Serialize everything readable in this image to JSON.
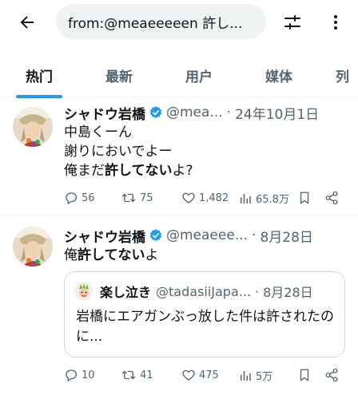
{
  "search": {
    "query": "from:@meaeeeeen 許し..."
  },
  "tabs": [
    {
      "label": "热门"
    },
    {
      "label": "最新"
    },
    {
      "label": "用户"
    },
    {
      "label": "媒体"
    },
    {
      "label": "列"
    }
  ],
  "tweets": [
    {
      "name": "シャドウ岩橋",
      "handle": "@mea...",
      "dot": "·",
      "date": "24年10月1日",
      "lines": [
        "中島くーん",
        "謝りにおいでよー"
      ],
      "line3_pre": "俺まだ",
      "line3_bold": "許してない",
      "line3_post": "よ?",
      "replies": "56",
      "retweets": "75",
      "likes": "1,482",
      "views": "65.8万"
    },
    {
      "name": "シャドウ岩橋",
      "handle": "@meaeee...",
      "dot": "·",
      "date": "8月28日",
      "text_pre": "俺",
      "text_bold": "許してない",
      "text_post": "よ",
      "quote": {
        "name": "楽し泣き",
        "handle": "@tadasiiJapa...",
        "dot": "·",
        "date": "8月28日",
        "text": "岩橋にエアガンぶっ放した件は許されたのに..."
      },
      "replies": "10",
      "retweets": "41",
      "likes": "475",
      "views": "5万"
    }
  ],
  "colors": {
    "accent": "#1d9bf0",
    "secondary_text": "#536471"
  },
  "icons": [
    "back-arrow-icon",
    "filter-icon",
    "more-vertical-icon",
    "verified-badge-icon",
    "reply-icon",
    "retweet-icon",
    "like-icon",
    "views-icon",
    "bookmark-icon",
    "share-icon"
  ]
}
